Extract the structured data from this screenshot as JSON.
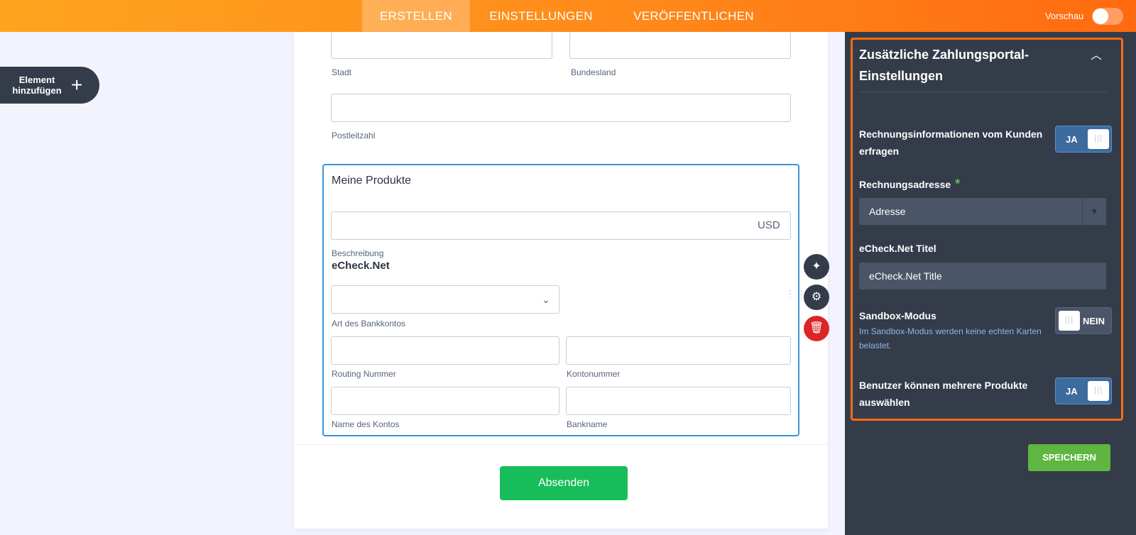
{
  "topbar": {
    "tabs": [
      {
        "label": "ERSTELLEN",
        "active": true
      },
      {
        "label": "EINSTELLUNGEN",
        "active": false
      },
      {
        "label": "VERÖFFENTLICHEN",
        "active": false
      }
    ],
    "preview_label": "Vorschau",
    "preview_on": false,
    "accent": "#ff8a1a"
  },
  "add_element": {
    "label": "Element hinzufügen",
    "icon": "plus-icon"
  },
  "form": {
    "fields": {
      "stadt": "Stadt",
      "bundesland": "Bundesland",
      "postleitzahl": "Postleitzahl"
    },
    "products": {
      "title": "Meine Produkte",
      "currency": "USD",
      "beschreibung": "Beschreibung",
      "echeck_heading": "eCheck.Net",
      "bank_type_label": "Art des Bankkontos",
      "routing_label": "Routing Nummer",
      "account_number_label": "Kontonummer",
      "account_name_label": "Name des Kontos",
      "bank_name_label": "Bankname"
    },
    "submit_label": "Absenden"
  },
  "side_actions": [
    "wand-icon",
    "gear-icon",
    "trash-icon"
  ],
  "panel": {
    "title": "Zusätzliche Zahlungsportal-Einstellungen",
    "billing_info": {
      "label": "Rechnungsinformationen vom Kunden erfragen",
      "value": "JA"
    },
    "billing_address": {
      "label": "Rechnungsadresse",
      "required_mark": "*",
      "selected": "Adresse"
    },
    "echeck_title": {
      "label": "eCheck.Net Titel",
      "value": "eCheck.Net Title"
    },
    "sandbox": {
      "label": "Sandbox-Modus",
      "help": "Im Sandbox-Modus werden keine echten Karten belastet.",
      "value": "NEIN"
    },
    "multi_products": {
      "label": "Benutzer können mehrere Produkte auswählen",
      "value": "JA"
    },
    "save_label": "SPEICHERN"
  }
}
